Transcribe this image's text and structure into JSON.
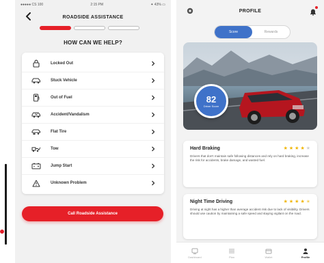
{
  "colors": {
    "accent_red": "#e62028",
    "accent_blue": "#3f72c9",
    "gold_star": "#f0b400"
  },
  "roadside": {
    "status_bar": {
      "carrier": "●●●●● CS 100",
      "time": "2:15 PM",
      "battery": "✦ 43% ▭"
    },
    "title": "ROADSIDE ASSISTANCE",
    "progress": {
      "steps": 3,
      "current": 1
    },
    "question": "HOW CAN WE HELP?",
    "options": [
      {
        "label": "Locked Out",
        "icon": "lock-icon"
      },
      {
        "label": "Stuck Vehicle",
        "icon": "stuck-car-icon"
      },
      {
        "label": "Out of Fuel",
        "icon": "fuel-icon"
      },
      {
        "label": "Accident/Vandalism",
        "icon": "accident-car-icon"
      },
      {
        "label": "Flat Tire",
        "icon": "flat-tire-icon"
      },
      {
        "label": "Tow",
        "icon": "tow-truck-icon"
      },
      {
        "label": "Jump Start",
        "icon": "battery-icon"
      },
      {
        "label": "Unknown Problem",
        "icon": "warning-icon"
      }
    ],
    "cta_label": "Call Roadside Assistance"
  },
  "profile": {
    "title": "PROFILE",
    "toggle": {
      "left": "Score",
      "right": "Rewards",
      "selected": "left"
    },
    "score": {
      "value": "82",
      "label": "Driver Score"
    },
    "cards": [
      {
        "title": "Hard Braking",
        "rating": 4,
        "body": "Drivers that don't maintain safe following distances and rely on hard braking, increase the risk for accidents, brake damage, and wasted fuel."
      },
      {
        "title": "Night Time Driving",
        "rating": 4.5,
        "body": "Driving at night has a higher than average accident risk due to lack of visibility. Drivers should use caution by maintaining a safe speed and staying vigilant on the road."
      }
    ],
    "tabs": [
      {
        "label": "Dashboard",
        "icon": "dashboard-icon"
      },
      {
        "label": "Plan",
        "icon": "list-icon"
      },
      {
        "label": "Wallet",
        "icon": "wallet-icon"
      },
      {
        "label": "Profile",
        "icon": "profile-icon",
        "active": true
      }
    ]
  }
}
